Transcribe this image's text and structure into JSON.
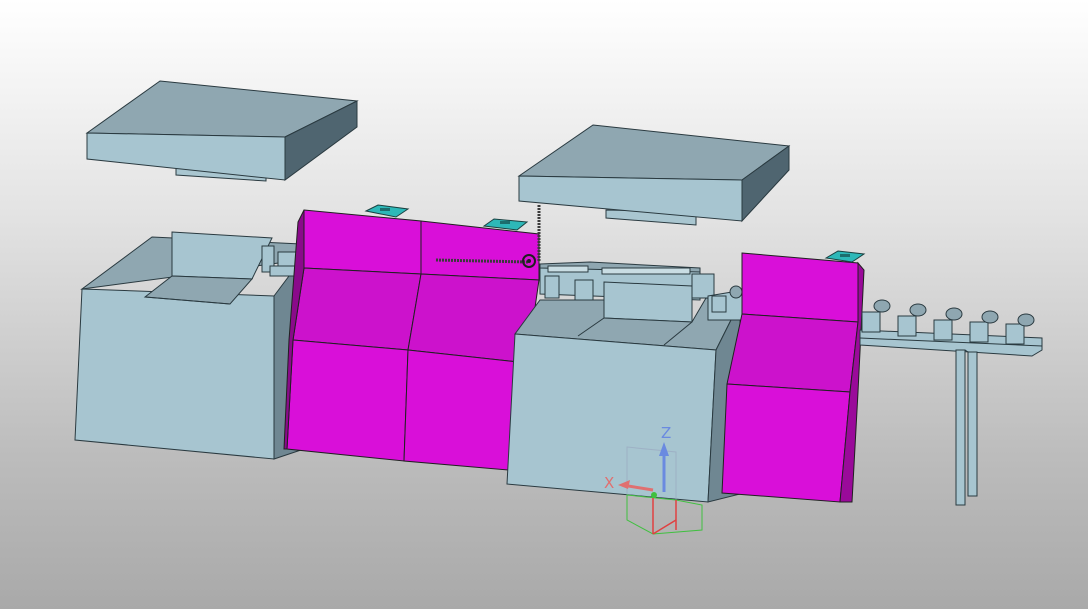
{
  "viewer": {
    "background_top": "#ffffff",
    "background_bottom": "#a9a9a9"
  },
  "colors": {
    "frame": "#a7c5d0",
    "frame_top": "#8fa7b1",
    "frame_side": "#6f8792",
    "frame_dark": "#4f6570",
    "module": "#d90fd9",
    "module_top": "#c412c4",
    "module_side": "#9a0a9a",
    "panel": "#2db8b8",
    "axis_x": "#e04040",
    "axis_y": "#40c040",
    "axis_z": "#4a7ad8"
  },
  "compass": {
    "x_label": "X",
    "z_label": "Z"
  }
}
